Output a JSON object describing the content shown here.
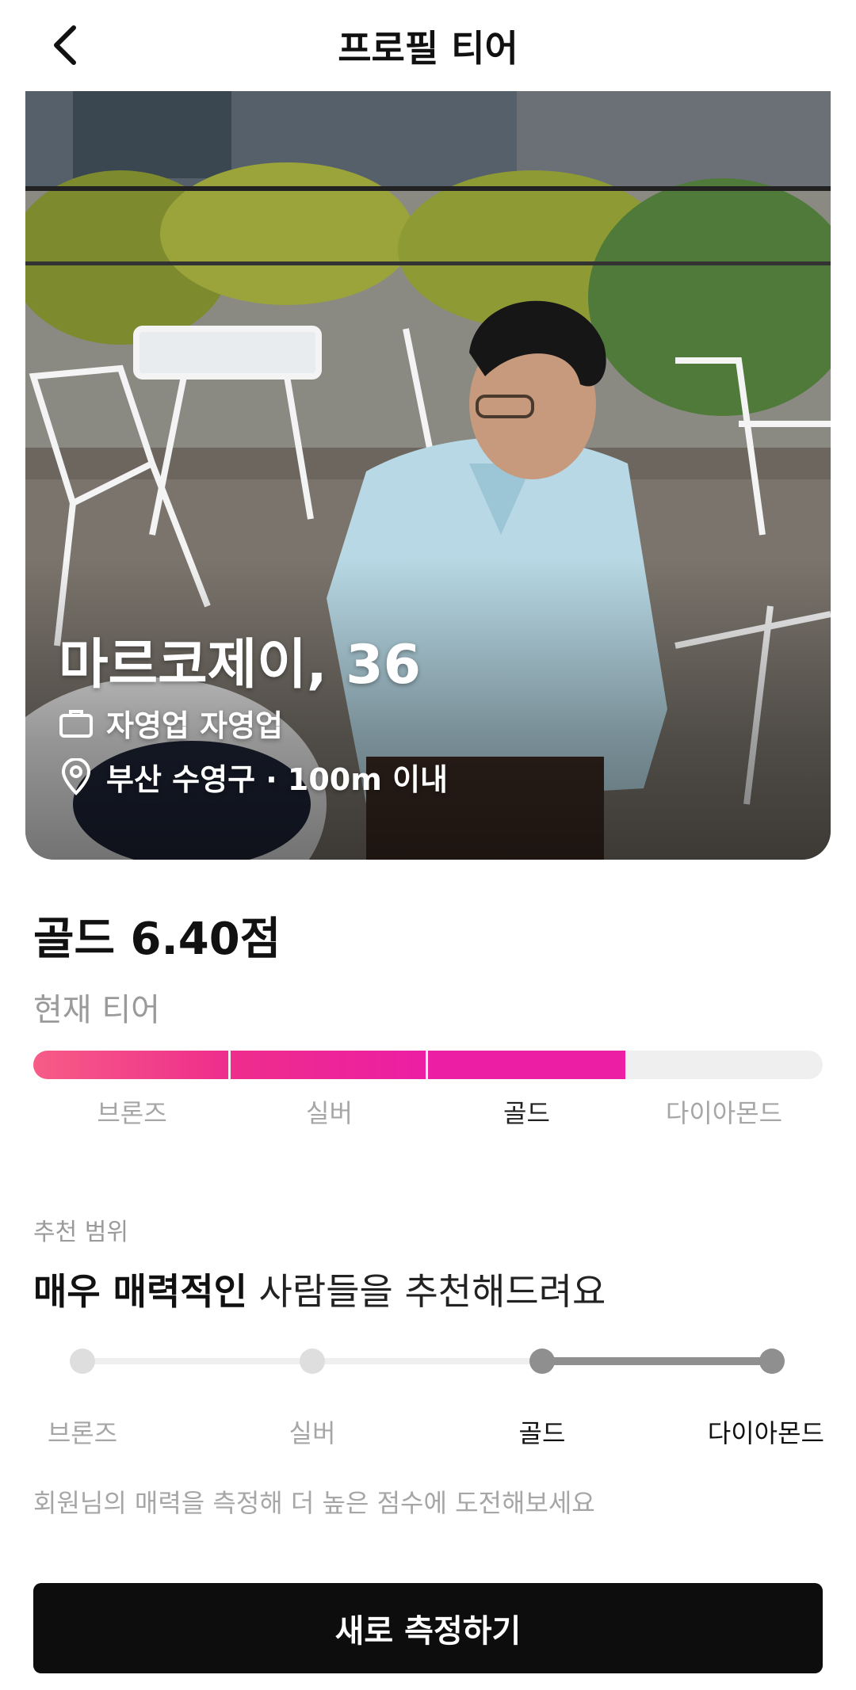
{
  "header": {
    "title": "프로필 티어",
    "back_icon": "chevron-left-icon"
  },
  "profile": {
    "name_age": "마르코제이, 36",
    "job": "자영업 자영업",
    "location": "부산 수영구 · 100m 이내",
    "job_icon": "briefcase-icon",
    "location_icon": "location-pin-icon",
    "photo": "outdoor-cafe-man-photo"
  },
  "score": {
    "title": "골드 6.40점",
    "current_tier_label": "현재 티어",
    "tiers": [
      "브론즈",
      "실버",
      "골드",
      "다이아몬드"
    ],
    "active_tier_index": 2,
    "filled_fraction": 0.75,
    "bar_colors": [
      "#f75c86",
      "#ee2d8c",
      "#ec1ea3"
    ]
  },
  "recommendation": {
    "small_label": "추천 범위",
    "headline_bold": "매우 매력적인",
    "headline_rest": " 사람들을 추천해드려요",
    "tiers": [
      "브론즈",
      "실버",
      "골드",
      "다이아몬드"
    ],
    "range_start_index": 2,
    "range_end_index": 3
  },
  "hint": "회원님의 매력을 측정해 더 높은 점수에 도전해보세요",
  "cta_label": "새로 측정하기",
  "colors": {
    "accent_pink": "#ec1ea3",
    "button_bg": "#0d0d0d",
    "muted_text": "#a6a6a6"
  }
}
